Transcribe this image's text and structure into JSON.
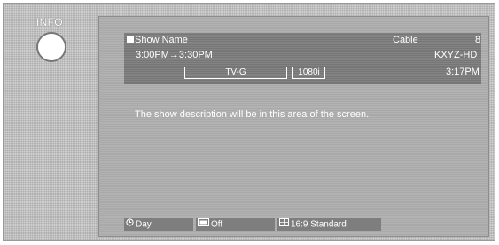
{
  "info": {
    "label": "INFO"
  },
  "banner": {
    "show_name": "Show Name",
    "source": "Cable",
    "channel": "8",
    "time_range": "3:00PM→3:30PM",
    "station": "KXYZ-HD",
    "rating": "TV-G",
    "resolution": "1080i",
    "clock": "3:17PM"
  },
  "description": "The show description will be in this area of the screen.",
  "bottom": {
    "timer": "Day",
    "cc": "Off",
    "aspect": "16:9 Standard"
  }
}
